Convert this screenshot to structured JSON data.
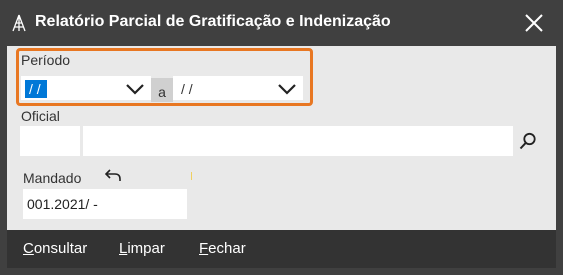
{
  "window": {
    "title": "Relatório Parcial de Gratificação e Indenização",
    "icon": "app-logo-icon",
    "close_icon": "close-icon"
  },
  "periodo": {
    "label": "Período",
    "from_value": "/ /",
    "separator": "a",
    "to_value": "/ /"
  },
  "oficial": {
    "label": "Oficial",
    "code_value": "",
    "name_value": "",
    "search_icon": "search-icon"
  },
  "mandado": {
    "label": "Mandado",
    "value": "001.2021/      -",
    "undo_icon": "undo-arrow-icon"
  },
  "footer": {
    "buttons": [
      {
        "first": "C",
        "rest": "onsultar"
      },
      {
        "first": "L",
        "rest": "impar"
      },
      {
        "first": "F",
        "rest": "echar"
      }
    ]
  },
  "colors": {
    "titlebar": "#404040",
    "body": "#e9e9e9",
    "footer": "#333333",
    "highlight": "#e87722",
    "selection": "#0078d7"
  }
}
